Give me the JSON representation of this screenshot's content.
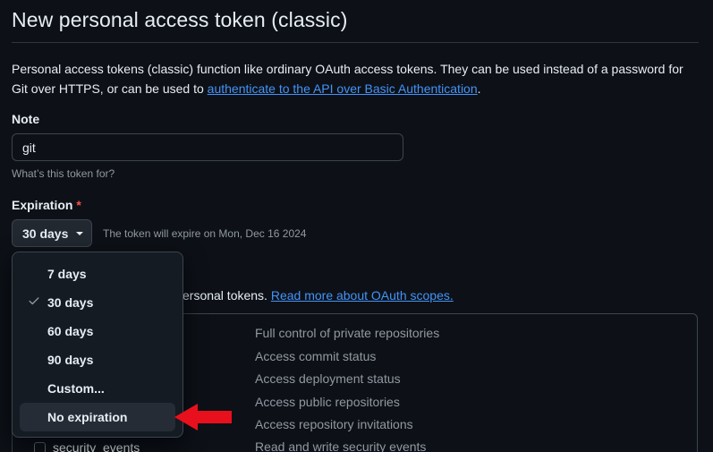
{
  "header": {
    "title": "New personal access token (classic)"
  },
  "description": {
    "text_before": "Personal access tokens (classic) function like ordinary OAuth access tokens. They can be used instead of a password for Git over HTTPS, or can be used to ",
    "link": "authenticate to the API over Basic Authentication",
    "text_after": "."
  },
  "note": {
    "label": "Note",
    "value": "git",
    "hint": "What’s this token for?"
  },
  "expiration": {
    "label": "Expiration",
    "required_mark": "*",
    "selected": "30 days",
    "expire_text": "The token will expire on Mon, Dec 16 2024",
    "options": [
      "7 days",
      "30 days",
      "60 days",
      "90 days",
      "Custom...",
      "No expiration"
    ],
    "checked_option": "30 days",
    "highlighted_option": "No expiration"
  },
  "scopes": {
    "intro_partial": "ersonal tokens.",
    "link": "Read more about OAuth scopes.",
    "descriptions": [
      "Full control of private repositories",
      "Access commit status",
      "Access deployment status",
      "Access public repositories",
      "Access repository invitations",
      "Read and write security events"
    ],
    "visible_scope_name": "security_events"
  },
  "colors": {
    "background": "#0d1117",
    "link": "#4493f8",
    "required": "#f85149",
    "annotation_arrow": "#e8101c"
  },
  "icons": {
    "caret": "caret-down-icon",
    "check": "check-icon",
    "annotation": "red-arrow-icon"
  }
}
